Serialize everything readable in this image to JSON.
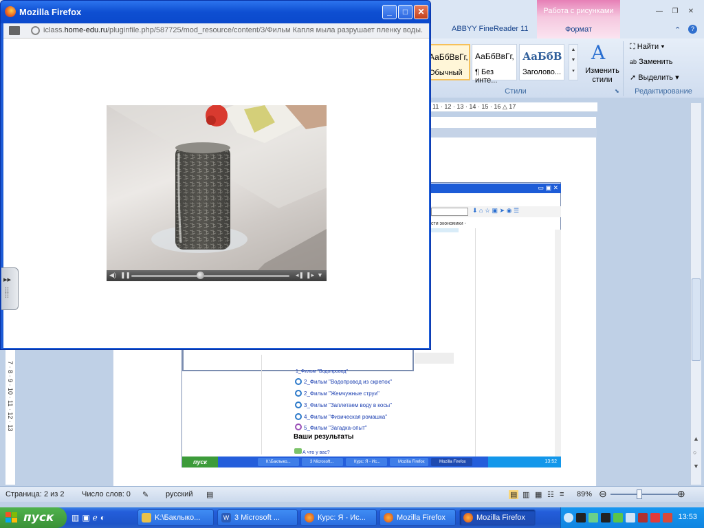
{
  "firefox": {
    "title": "Mozilla Firefox",
    "url_prefix": "iclass.",
    "url_domain": "home-edu.ru",
    "url_path": "/pluginfile.php/587725/mod_resource/content/3/Фильм Капля мыла разрушает пленку воды.",
    "minimize": "_",
    "maximize": "□",
    "close": "✕"
  },
  "word": {
    "abbyy_tab": "ABBYY FineReader 11",
    "context_group": "Работа с рисунками",
    "format_tab": "Формат",
    "styles": [
      {
        "sample": "АаБбВвГг,",
        "name": "Обычный"
      },
      {
        "sample": "АаБбВвГг,",
        "name": "¶ Без инте..."
      },
      {
        "sample": "АаБбВ",
        "name": "Заголово..."
      }
    ],
    "change_styles": "Изменить стили",
    "styles_group": "Стили",
    "find": "Найти",
    "replace": "Заменить",
    "select": "Выделить",
    "editing_group": "Редактирование",
    "ruler": "11 · 12 · 13 · 14 · 15 · 16 △ 17",
    "vruler": "7 · 8 · 9 · 10 · 11 · 12 · 13"
  },
  "embedded": {
    "bookmark": "сти экономики -",
    "links": [
      "1_Фильм \"Водопровод\"",
      "2_Фильм \"Водопровод из скрепок\"",
      "2_Фильм \"Жемчужные струи\"",
      "3_Фильм \"Заплетаем воду в косы\"",
      "4_Фильм \"Физическая ромашка\"",
      "5_Фильм \"Загадка-опыт\""
    ],
    "results": "Ваши результаты",
    "what": "А что у вас?",
    "start": "пуск",
    "tasks": [
      "К:\\Баклыко...",
      "3 Microsoft...",
      "Курс: Я - Ис...",
      "Mozilla Firefox",
      "Mozilla Firefox"
    ],
    "clock": "13:52"
  },
  "statusbar": {
    "page": "Страница: 2 из 2",
    "words": "Число слов: 0",
    "language": "русский",
    "zoom": "89%"
  },
  "taskbar": {
    "start": "пуск",
    "tasks": [
      {
        "label": "K:\\Баклыко..."
      },
      {
        "label": "3 Microsoft ..."
      },
      {
        "label": "Курс: Я - Ис..."
      },
      {
        "label": "Mozilla Firefox"
      },
      {
        "label": "Mozilla Firefox"
      }
    ],
    "clock": "13:53"
  }
}
